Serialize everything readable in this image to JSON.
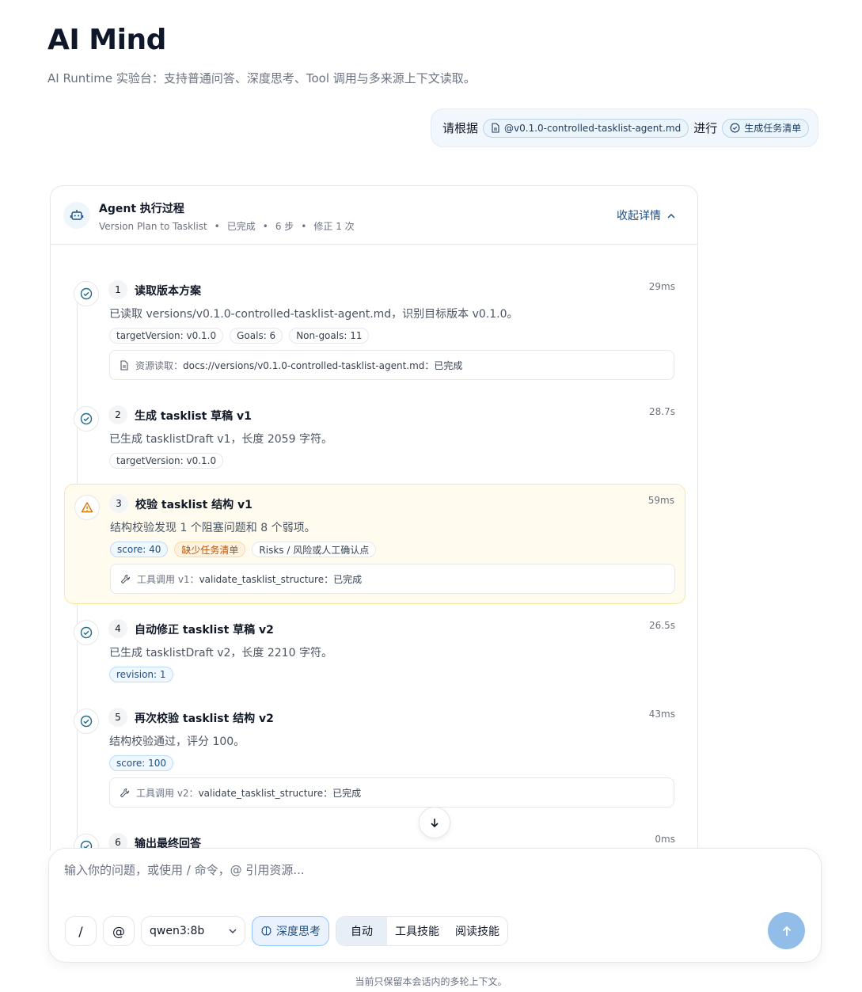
{
  "header": {
    "title": "AI Mind",
    "subtitle": "AI Runtime 实验台：支持普通问答、深度思考、Tool 调用与多来源上下文读取。"
  },
  "user_message": {
    "prefix": "请根据",
    "file_chip": "@v0.1.0-controlled-tasklist-agent.md",
    "middle": "进行",
    "command_chip": "生成任务清单"
  },
  "agent": {
    "title": "Agent 执行过程",
    "meta": [
      "Version Plan to Tasklist",
      "已完成",
      "6 步",
      "修正 1 次"
    ],
    "collapse_label": "收起详情",
    "steps": [
      {
        "num": "1",
        "title": "读取版本方案",
        "time": "29ms",
        "status": "success",
        "desc": "已读取 versions/v0.1.0-controlled-tasklist-agent.md，识别目标版本 v0.1.0。",
        "tags": [
          "targetVersion: v0.1.0",
          "Goals: 6",
          "Non-goals: 11"
        ],
        "detail_label": "资源读取：",
        "detail_value": "docs://versions/v0.1.0-controlled-tasklist-agent.md：已完成"
      },
      {
        "num": "2",
        "title": "生成 tasklist 草稿 v1",
        "time": "28.7s",
        "status": "success",
        "desc": "已生成 tasklistDraft v1，长度 2059 字符。",
        "tags": [
          "targetVersion: v0.1.0"
        ]
      },
      {
        "num": "3",
        "title": "校验 tasklist 结构 v1",
        "time": "59ms",
        "status": "warning",
        "desc": "结构校验发现 1 个阻塞问题和 8 个弱项。",
        "tags": [
          "score: 40",
          "缺少任务清单",
          "Risks / 风险或人工确认点"
        ],
        "detail_label": "工具调用 v1：",
        "detail_value": "validate_tasklist_structure：已完成"
      },
      {
        "num": "4",
        "title": "自动修正 tasklist 草稿 v2",
        "time": "26.5s",
        "status": "success",
        "desc": "已生成 tasklistDraft v2，长度 2210 字符。",
        "tags": [
          "revision: 1"
        ]
      },
      {
        "num": "5",
        "title": "再次校验 tasklist 结构 v2",
        "time": "43ms",
        "status": "success",
        "desc": "结构校验通过，评分 100。",
        "tags": [
          "score: 100"
        ],
        "detail_label": "工具调用 v2：",
        "detail_value": "validate_tasklist_structure：已完成"
      },
      {
        "num": "6",
        "title": "输出最终回答",
        "time": "0ms",
        "status": "success"
      }
    ]
  },
  "composer": {
    "placeholder": "输入你的问题，或使用 / 命令，@ 引用资源...",
    "slash_label": "/",
    "at_label": "@",
    "model": "qwen3:8b",
    "think_label": "深度思考",
    "modes": [
      "自动",
      "工具技能",
      "阅读技能"
    ],
    "active_mode": "自动"
  },
  "footer": {
    "note": "当前只保留本会话内的多轮上下文。"
  },
  "colors": {
    "accent": "#1d4f8a",
    "success_icon": "#1e6b8a",
    "warning_icon": "#d97706",
    "send_button": "#93bde9"
  }
}
